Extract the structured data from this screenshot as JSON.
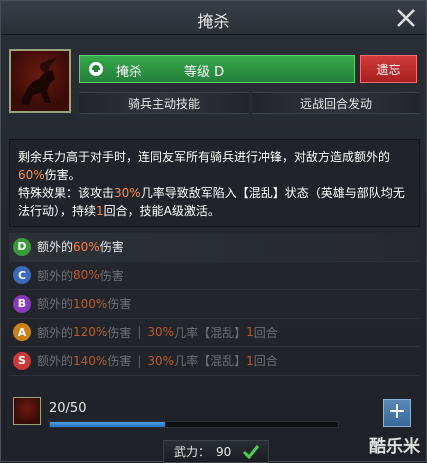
{
  "window": {
    "title": "掩杀"
  },
  "skill": {
    "name": "掩杀",
    "grade_label": "等级 D",
    "forget_label": "遗忘",
    "tags": [
      "骑兵主动技能",
      "远战回合发动"
    ]
  },
  "description": {
    "line1": "剩余兵力高于对手时，连同友军所有骑兵进行冲锋，对敌方造成额外的",
    "line1_pct": "60%",
    "line1_tail": "伤害。",
    "line2_head": "特殊效果：该攻击",
    "line2_pct": "30%",
    "line2_tail": "几率导致敌军陷入【混乱】状态（英雄与部队均无法行动），持续",
    "line2_turns": "1",
    "line2_end": "回合，技能A级激活。"
  },
  "grades": [
    {
      "letter": "D",
      "color": "#3a9a3a",
      "pre": "额外的",
      "pct": "60%",
      "post": "伤害",
      "extra": null,
      "active": true
    },
    {
      "letter": "C",
      "color": "#3a6ab8",
      "pre": "额外的",
      "pct": "80%",
      "post": "伤害",
      "extra": null,
      "active": false
    },
    {
      "letter": "B",
      "color": "#8a3ab8",
      "pre": "额外的",
      "pct": "100%",
      "post": "伤害",
      "extra": null,
      "active": false
    },
    {
      "letter": "A",
      "color": "#c8821a",
      "pre": "额外的",
      "pct": "120%",
      "post": "伤害",
      "extra": {
        "sep": "|",
        "pct": "30%",
        "mid": "几率【混乱】",
        "num": "1",
        "end": "回合"
      },
      "active": false
    },
    {
      "letter": "S",
      "color": "#c83a3a",
      "pre": "额外的",
      "pct": "140%",
      "post": "伤害",
      "extra": {
        "sep": "|",
        "pct": "30%",
        "mid": "几率【混乱】",
        "num": "1",
        "end": "回合"
      },
      "active": false
    }
  ],
  "footer": {
    "count": "20/50",
    "progress": 0.4,
    "plus_label": "+"
  },
  "power": {
    "label": "武力：",
    "value": "90"
  },
  "watermark": "酷乐米"
}
